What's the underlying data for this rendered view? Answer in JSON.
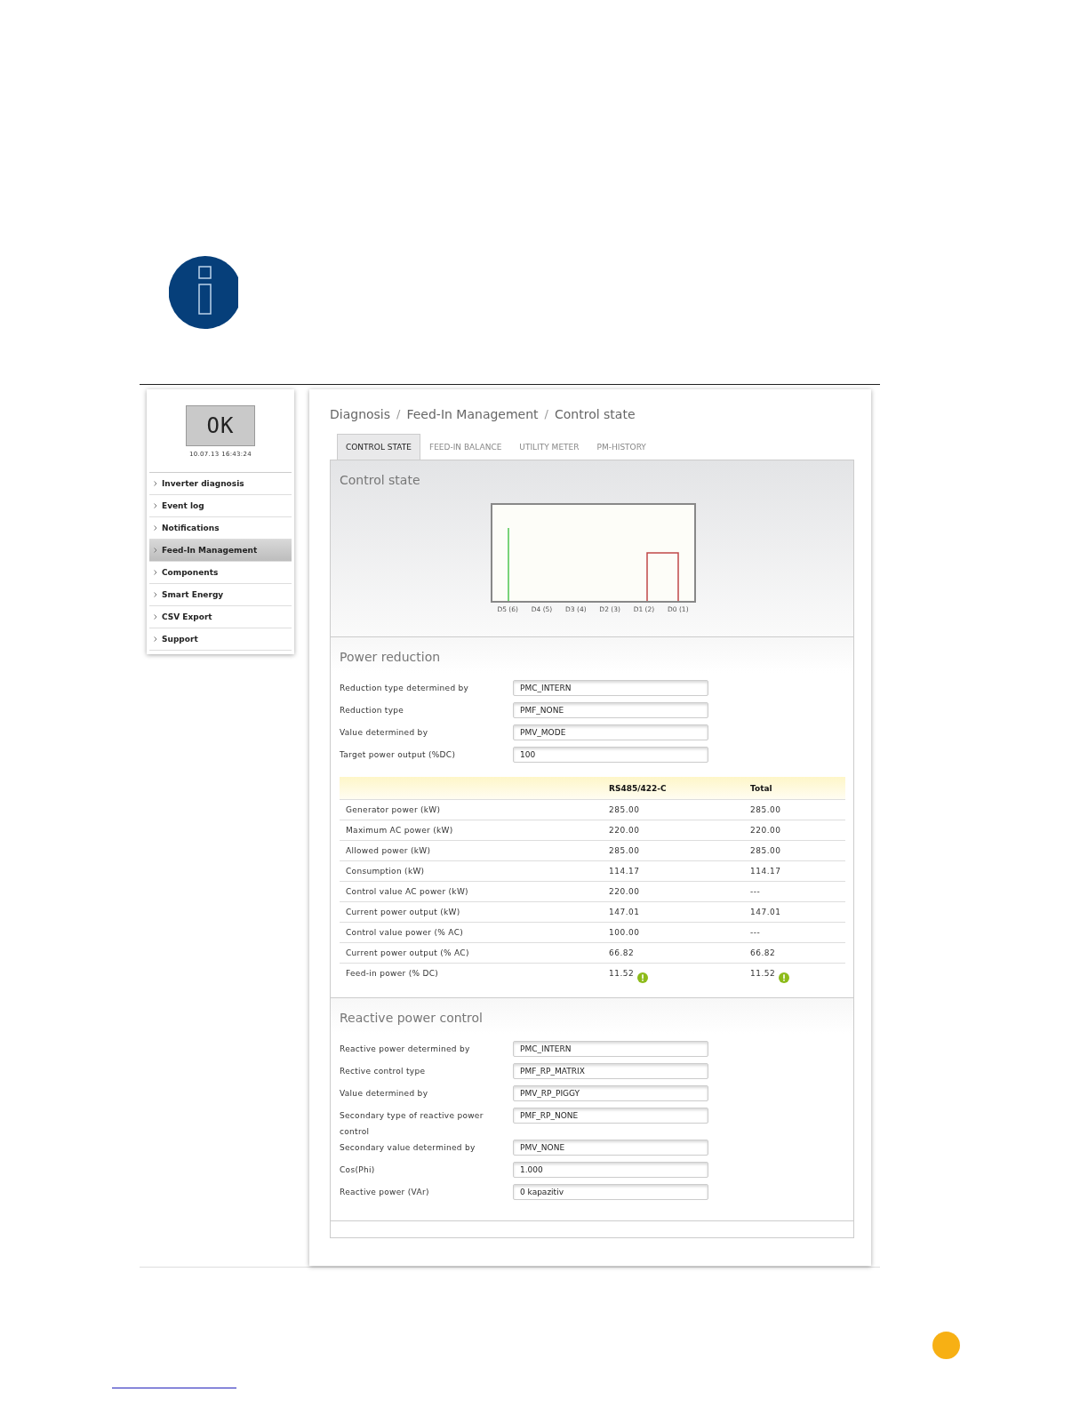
{
  "device": {
    "lcd_text": "OK",
    "timestamp": "10.07.13 16:43:24"
  },
  "sidebar": {
    "items": [
      {
        "label": "Inverter diagnosis",
        "selected": false
      },
      {
        "label": "Event log",
        "selected": false
      },
      {
        "label": "Notifications",
        "selected": false
      },
      {
        "label": "Feed-In Management",
        "selected": true
      },
      {
        "label": "Components",
        "selected": false
      },
      {
        "label": "Smart Energy",
        "selected": false
      },
      {
        "label": "CSV Export",
        "selected": false
      },
      {
        "label": "Support",
        "selected": false
      }
    ]
  },
  "breadcrumb": [
    {
      "kind": "link",
      "text": "Diagnosis"
    },
    {
      "kind": "separator",
      "text": "/"
    },
    {
      "kind": "link",
      "text": "Feed-In Management"
    },
    {
      "kind": "separator",
      "text": "/"
    },
    {
      "kind": "link",
      "text": "Control state"
    }
  ],
  "tabs": [
    {
      "label": "CONTROL STATE",
      "selected": true
    },
    {
      "label": "FEED-IN BALANCE",
      "selected": false
    },
    {
      "label": "UTILITY METER",
      "selected": false
    },
    {
      "label": "PM-HISTORY",
      "selected": false
    }
  ],
  "control_state": {
    "title": "Control state",
    "axis_labels": [
      "D5 (6)",
      "D4 (5)",
      "D3 (4)",
      "D2 (3)",
      "D1 (2)",
      "D0 (1)"
    ]
  },
  "power_reduction": {
    "title": "Power reduction",
    "fields": [
      {
        "label": "Reduction type determined by",
        "value": "PMC_INTERN"
      },
      {
        "label": "Reduction type",
        "value": "PMF_NONE"
      },
      {
        "label": "Value determined by",
        "value": "PMV_MODE"
      },
      {
        "label": "Target power output (%DC)",
        "value": "100"
      }
    ],
    "table": {
      "columns": [
        "RS485/422-C",
        "Total"
      ],
      "rows": [
        {
          "label": "Generator power (kW)",
          "values": [
            "285.00",
            "285.00"
          ],
          "flagged": false
        },
        {
          "label": "Maximum AC power (kW)",
          "values": [
            "220.00",
            "220.00"
          ],
          "flagged": false
        },
        {
          "label": "Allowed power (kW)",
          "values": [
            "285.00",
            "285.00"
          ],
          "flagged": false
        },
        {
          "label": "Consumption (kW)",
          "values": [
            "114.17",
            "114.17"
          ],
          "flagged": false
        },
        {
          "label": "Control value AC power (kW)",
          "values": [
            "220.00",
            "---"
          ],
          "flagged": false
        },
        {
          "label": "Current power output (kW)",
          "values": [
            "147.01",
            "147.01"
          ],
          "flagged": false
        },
        {
          "label": "Control value power (% AC)",
          "values": [
            "100.00",
            "---"
          ],
          "flagged": false
        },
        {
          "label": "Current power output (% AC)",
          "values": [
            "66.82",
            "66.82"
          ],
          "flagged": false
        },
        {
          "label": "Feed-in power (% DC)",
          "values": [
            "11.52",
            "11.52"
          ],
          "flagged": true
        }
      ]
    }
  },
  "reactive_power": {
    "title": "Reactive power control",
    "fields": [
      {
        "label": "Reactive power determined by",
        "value": "PMC_INTERN"
      },
      {
        "label": "Rective control type",
        "value": "PMF_RP_MATRIX"
      },
      {
        "label": "Value determined by",
        "value": "PMV_RP_PIGGY"
      },
      {
        "label": "Secondary type of reactive power control",
        "value": "PMF_RP_NONE"
      },
      {
        "label": "Secondary value determined by",
        "value": "PMV_NONE"
      },
      {
        "label": "Cos(Phi)",
        "value": "1.000"
      },
      {
        "label": "Reactive power (VAr)",
        "value": "0 kapazitiv"
      }
    ]
  }
}
